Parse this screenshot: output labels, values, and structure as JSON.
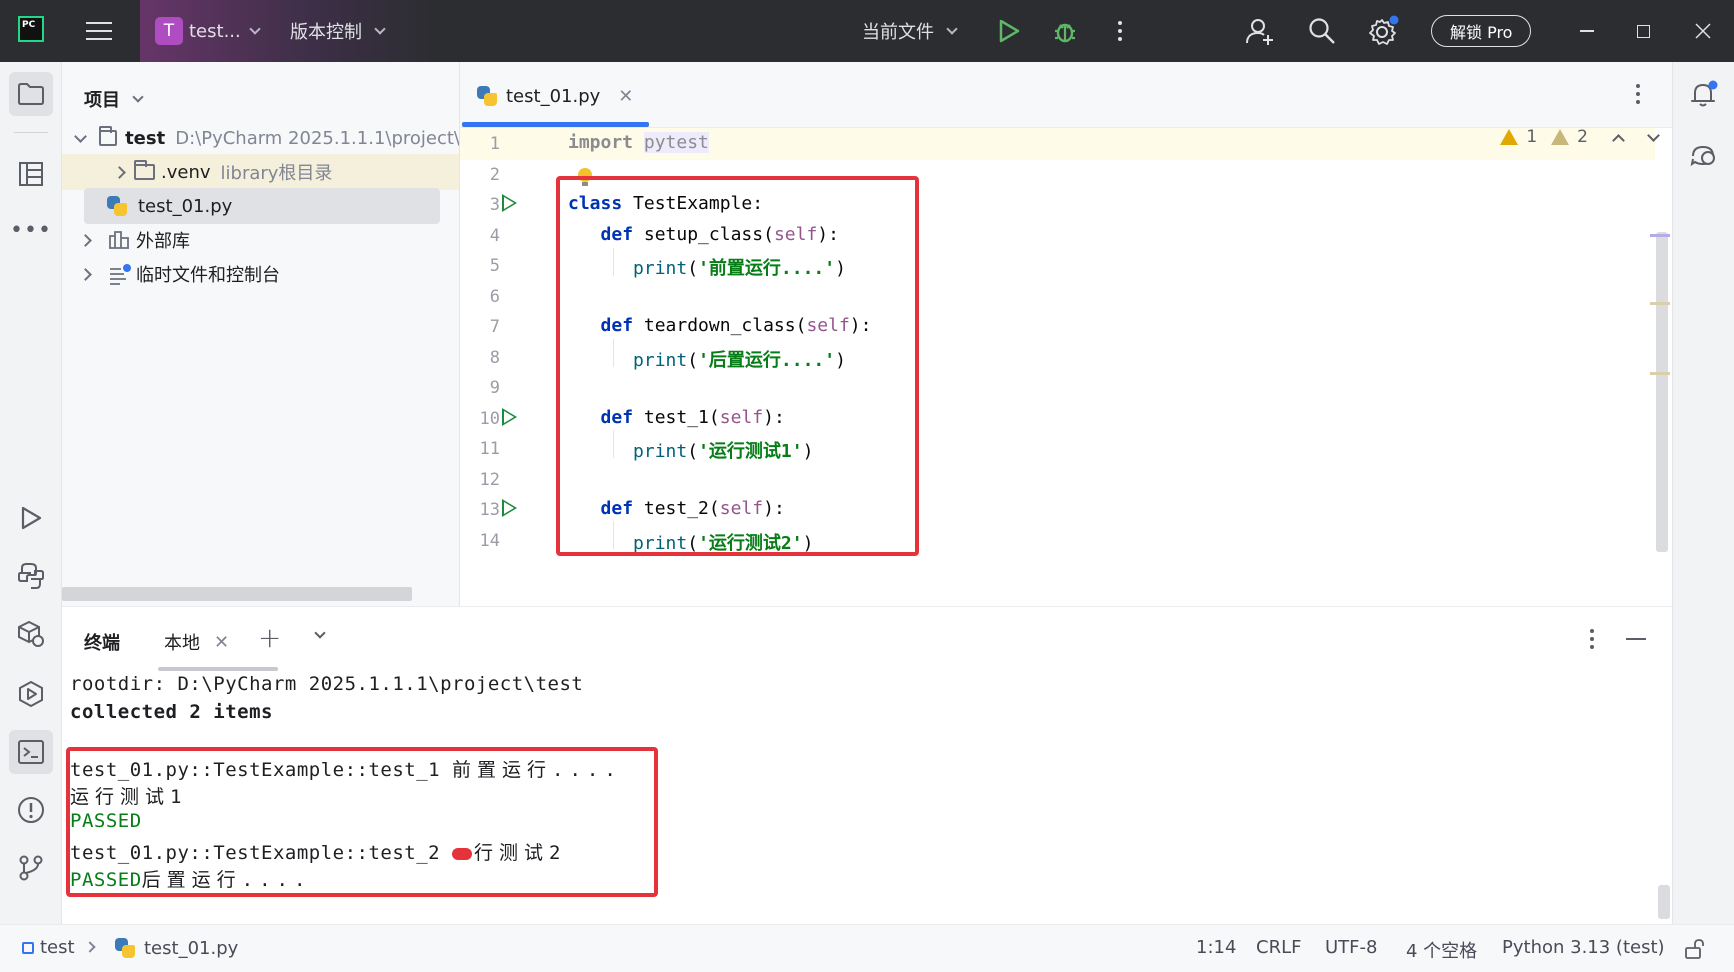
{
  "titlebar": {
    "project_initial": "T",
    "project_name": "test...",
    "vcs_label": "版本控制",
    "run_config": "当前文件",
    "pro_label": "解锁 Pro"
  },
  "project_panel": {
    "title": "项目",
    "root_name": "test",
    "root_path": "D:\\PyCharm 2025.1.1.1\\project\\",
    "venv_name": ".venv",
    "venv_hint": "library根目录",
    "file_name": "test_01.py",
    "ext_libs": "外部库",
    "scratches": "临时文件和控制台"
  },
  "editor": {
    "tab_label": "test_01.py",
    "warnings_count": "1",
    "weak_warnings_count": "2",
    "line_numbers": [
      "1",
      "2",
      "3",
      "4",
      "5",
      "6",
      "7",
      "8",
      "9",
      "10",
      "11",
      "12",
      "13",
      "14"
    ],
    "code": {
      "l1_kw": "import",
      "l1_mod": "pytest",
      "l3_kw": "class",
      "l3_name": " TestExample:",
      "l4_kw": "def",
      "l4_name": "setup_class",
      "l5_fn": "print",
      "l5_str": "'前置运行....'",
      "l7_kw": "def",
      "l7_name": "teardown_class",
      "l8_fn": "print",
      "l8_str": "'后置运行....'",
      "l10_kw": "def",
      "l10_name": "test_1",
      "l11_fn": "print",
      "l11_str": "'运行测试1'",
      "l13_kw": "def",
      "l13_name": "test_2",
      "l14_fn": "print",
      "l14_str": "'运行测试2'",
      "self": "self"
    }
  },
  "terminal": {
    "title": "终端",
    "tab_label": "本地",
    "lines": {
      "rootdir": "rootdir: D:\\PyCharm 2025.1.1.1\\project\\test",
      "collected": "collected 2 items",
      "t1_id": "test_01.py::TestExample::test_1 ",
      "t1_out": "前置运行....",
      "t1_run": "运行测试1",
      "passed1": "PASSED",
      "t2_id": "test_01.py::TestExample::test_2 ",
      "t2_out": "行测试2",
      "passed2": "PASSED",
      "teardown_out": "后置运行...."
    }
  },
  "statusbar": {
    "project": "test",
    "file": "test_01.py",
    "position": "1:14",
    "line_sep": "CRLF",
    "encoding": "UTF-8",
    "indent": "4 个空格",
    "interpreter": "Python 3.13 (test)"
  },
  "colors": {
    "accent": "#3574f0",
    "highlight_box": "#e5333c",
    "run_green": "#208a3c",
    "string_green": "#067d17",
    "keyword_blue": "#0033b3"
  }
}
